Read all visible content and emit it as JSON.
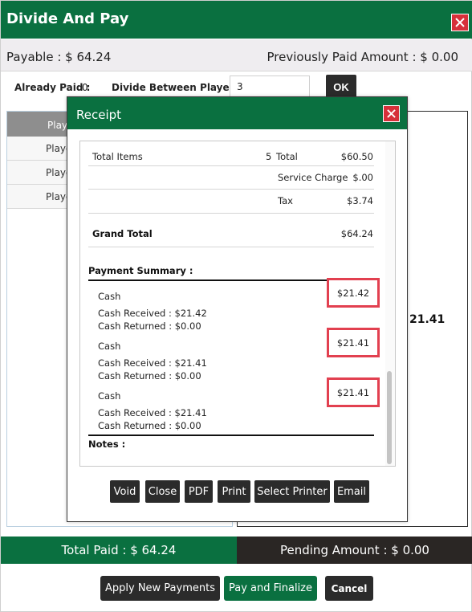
{
  "window": {
    "title": "Divide And Pay",
    "close_icon": "close-icon",
    "accent_color": "#0a7040"
  },
  "info": {
    "payable": "Payable : $ 64.24",
    "previously_paid": "Previously Paid Amount : $ 0.00"
  },
  "controls": {
    "already_paid_label": "Already Paid :",
    "already_paid_value": "0",
    "divide_label": "Divide Between Players :",
    "divide_value": "3",
    "ok_label": "OK"
  },
  "players": {
    "header": "Playe",
    "rows": [
      "Playe",
      "Playe",
      "Playe"
    ],
    "right_amount": "21.41"
  },
  "receipt": {
    "title": "Receipt",
    "total_items_label": "Total Items",
    "total_items_value": "5",
    "total_label": "Total",
    "total_value": "$60.50",
    "service_charge_label": "Service Charge",
    "service_charge_value": "$.00",
    "tax_label": "Tax",
    "tax_value": "$3.74",
    "grand_total_label": "Grand Total",
    "grand_total_value": "$64.24",
    "payment_summary_label": "Payment Summary :",
    "payments": [
      {
        "method": "Cash",
        "amount": "$21.42",
        "received": "Cash Received : $21.42",
        "returned": "Cash Returned : $0.00"
      },
      {
        "method": "Cash",
        "amount": "$21.41",
        "received": "Cash Received : $21.41",
        "returned": "Cash Returned : $0.00"
      },
      {
        "method": "Cash",
        "amount": "$21.41",
        "received": "Cash Received : $21.41",
        "returned": "Cash Returned : $0.00"
      }
    ],
    "notes_label": "Notes :",
    "buttons": {
      "void": "Void",
      "close": "Close",
      "pdf": "PDF",
      "print": "Print",
      "select_printer": "Select Printer",
      "email": "Email"
    }
  },
  "footer": {
    "total_paid": "Total Paid : $ 64.24",
    "pending_amount": "Pending Amount : $ 0.00",
    "apply_new_payments": "Apply New Payments",
    "pay_and_finalize": "Pay and Finalize",
    "cancel": "Cancel"
  }
}
